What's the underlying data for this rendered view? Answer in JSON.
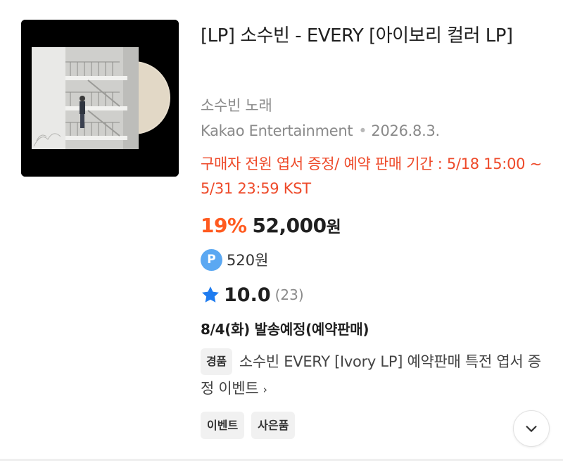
{
  "product": {
    "title": "[LP] 소수빈 - EVERY [아이보리 컬러 LP]",
    "artist_label": "소수빈 노래",
    "publisher": "Kakao Entertainment",
    "release_date": "2026.8.3.",
    "notice": "구매자 전원 엽서 증정/ 예약 판매 기간 : 5/18 15:00 ~ 5/31 23:59 KST",
    "discount": "19%",
    "price": "52,000",
    "price_unit": "원",
    "point_badge": "P",
    "points": "520원",
    "rating": "10.0",
    "rating_count": "(23)",
    "shipping": "8/4(화) 발송예정(예약판매)",
    "gift_tag": "경품",
    "gift_text": "소수빈 EVERY [Ivory LP] 예약판매 특전 엽서 증정 이벤트",
    "gift_chevron": "›",
    "tags": [
      "이벤트",
      "사은품"
    ]
  },
  "icons": {
    "point": "point-badge-icon",
    "star": "star-icon",
    "expand": "chevron-down-icon"
  },
  "colors": {
    "accent_orange": "#ff5a1f",
    "notice_red": "#ee4a2a",
    "point_blue": "#5ba8f2",
    "star_blue": "#1f7cf0",
    "muted_gray": "#8a8a8a"
  }
}
